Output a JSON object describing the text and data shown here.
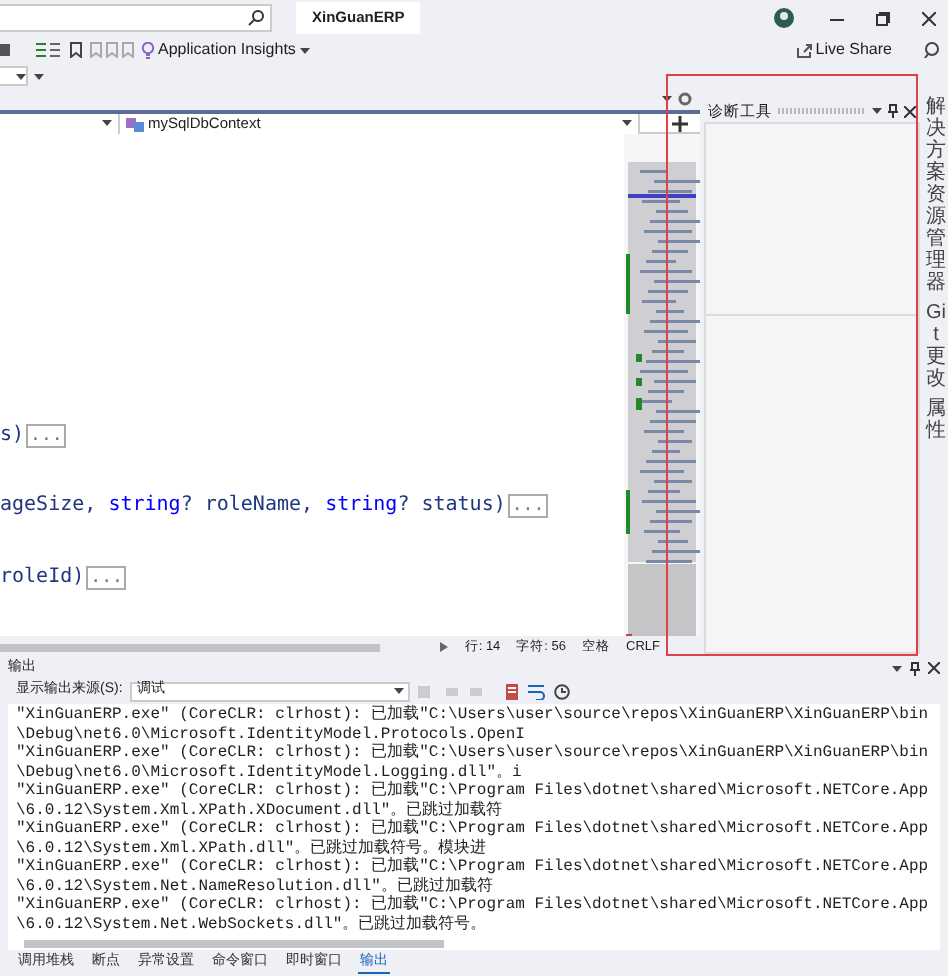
{
  "title_bar": {
    "project_title": "XinGuanERP"
  },
  "toolbar": {
    "insights": "Application Insights",
    "live_share": "Live Share"
  },
  "editor": {
    "member_dropdown": "mySqlDbContext",
    "code_lines": [
      {
        "segments": [
          {
            "kind": "plain",
            "text": "s)"
          }
        ],
        "fold_text": "..."
      },
      {
        "segments": [
          {
            "kind": "plain",
            "text": "ageSize, "
          },
          {
            "kind": "keyword",
            "text": "string"
          },
          {
            "kind": "plain",
            "text": "? roleName, "
          },
          {
            "kind": "keyword",
            "text": "string"
          },
          {
            "kind": "plain",
            "text": "? status)"
          }
        ],
        "fold_text": "..."
      },
      {
        "segments": [
          {
            "kind": "plain",
            "text": "roleId)"
          }
        ],
        "fold_text": "..."
      }
    ],
    "status": {
      "line": "行: 14",
      "column": "字符: 56",
      "indent": "空格",
      "line_ending": "CRLF"
    }
  },
  "diagnostics": {
    "title": "诊断工具"
  },
  "side_tabs": [
    "解决方案资源管理器",
    "Git 更改",
    "属性"
  ],
  "output": {
    "title": "输出",
    "source_label": "显示输出来源(S):",
    "source": "调试",
    "lines": [
      "\"XinGuanERP.exe\" (CoreCLR: clrhost): 已加载\"C:\\Users\\user\\source\\repos\\XinGuanERP\\XinGuanERP\\bin\\Debug\\net6.0\\Microsoft.IdentityModel.Protocols.OpenI",
      "\"XinGuanERP.exe\" (CoreCLR: clrhost): 已加载\"C:\\Users\\user\\source\\repos\\XinGuanERP\\XinGuanERP\\bin\\Debug\\net6.0\\Microsoft.IdentityModel.Logging.dll\"。i",
      "\"XinGuanERP.exe\" (CoreCLR: clrhost): 已加载\"C:\\Program Files\\dotnet\\shared\\Microsoft.NETCore.App\\6.0.12\\System.Xml.XPath.XDocument.dll\"。已跳过加载符",
      "\"XinGuanERP.exe\" (CoreCLR: clrhost): 已加载\"C:\\Program Files\\dotnet\\shared\\Microsoft.NETCore.App\\6.0.12\\System.Xml.XPath.dll\"。已跳过加载符号。模块进",
      "\"XinGuanERP.exe\" (CoreCLR: clrhost): 已加载\"C:\\Program Files\\dotnet\\shared\\Microsoft.NETCore.App\\6.0.12\\System.Net.NameResolution.dll\"。已跳过加载符",
      "\"XinGuanERP.exe\" (CoreCLR: clrhost): 已加载\"C:\\Program Files\\dotnet\\shared\\Microsoft.NETCore.App\\6.0.12\\System.Net.WebSockets.dll\"。已跳过加载符号。"
    ]
  },
  "bottom_tabs": [
    {
      "label": "调用堆栈",
      "selected": false
    },
    {
      "label": "断点",
      "selected": false
    },
    {
      "label": "异常设置",
      "selected": false
    },
    {
      "label": "命令窗口",
      "selected": false
    },
    {
      "label": "即时窗口",
      "selected": false
    },
    {
      "label": "输出",
      "selected": true
    }
  ]
}
